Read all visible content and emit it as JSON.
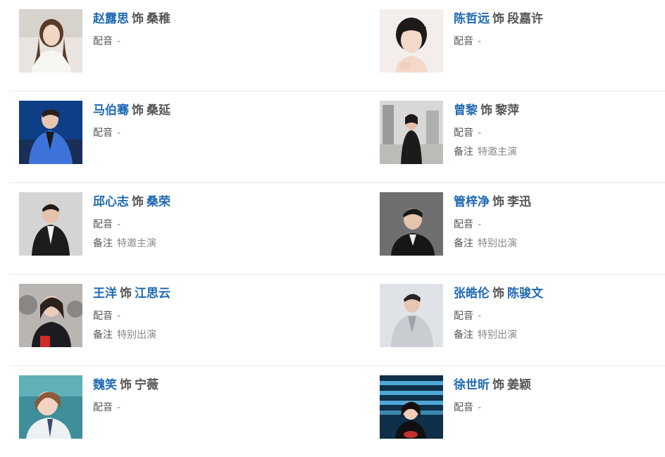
{
  "colors": {
    "link": "#1f69b3",
    "text": "#555555",
    "muted": "#888888",
    "divider": "#e9e9e9"
  },
  "labels": {
    "as": "饰",
    "dub": "配音",
    "note": "备注"
  },
  "cast": [
    {
      "actor": "赵露思",
      "role": "桑稚",
      "role_linked": false,
      "dub": "-",
      "note": null,
      "photo_icon": "portrait-photo"
    },
    {
      "actor": "陈哲远",
      "role": "段嘉许",
      "role_linked": false,
      "dub": "-",
      "note": null,
      "photo_icon": "portrait-photo"
    },
    {
      "actor": "马伯骞",
      "role": "桑延",
      "role_linked": false,
      "dub": "-",
      "note": null,
      "photo_icon": "portrait-photo"
    },
    {
      "actor": "曾黎",
      "role": "黎萍",
      "role_linked": false,
      "dub": "-",
      "note": "特邀主演",
      "photo_icon": "portrait-photo"
    },
    {
      "actor": "邱心志",
      "role": "桑荣",
      "role_linked": true,
      "dub": "-",
      "note": "特邀主演",
      "photo_icon": "portrait-photo"
    },
    {
      "actor": "管梓净",
      "role": "李迅",
      "role_linked": false,
      "dub": "-",
      "note": "特别出演",
      "photo_icon": "portrait-photo"
    },
    {
      "actor": "王洋",
      "role": "江思云",
      "role_linked": true,
      "dub": "-",
      "note": "特别出演",
      "photo_icon": "portrait-photo"
    },
    {
      "actor": "张皓伦",
      "role": "陈骏文",
      "role_linked": true,
      "dub": "-",
      "note": "特别出演",
      "photo_icon": "portrait-photo"
    },
    {
      "actor": "魏笑",
      "role": "宁薇",
      "role_linked": false,
      "dub": "-",
      "note": null,
      "photo_icon": "portrait-photo"
    },
    {
      "actor": "徐世昕",
      "role": "姜颖",
      "role_linked": false,
      "dub": "-",
      "note": null,
      "photo_icon": "portrait-photo"
    }
  ]
}
